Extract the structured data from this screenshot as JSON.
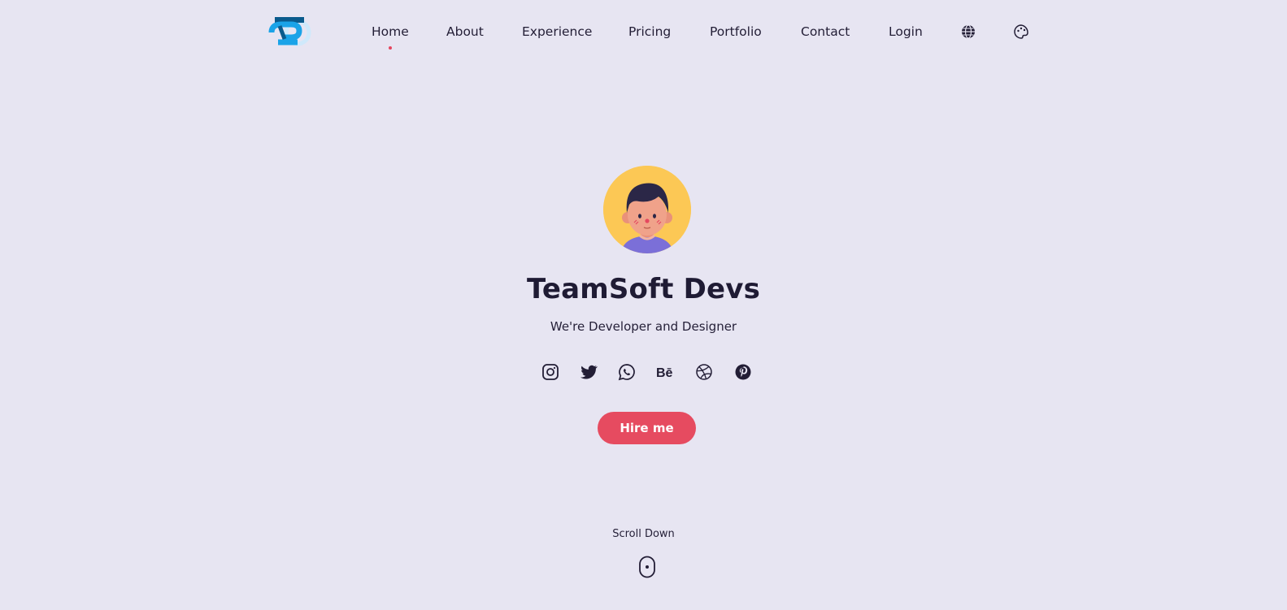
{
  "nav": {
    "items": [
      {
        "label": "Home",
        "active": true
      },
      {
        "label": "About",
        "active": false
      },
      {
        "label": "Experience",
        "active": false
      },
      {
        "label": "Pricing",
        "active": false
      },
      {
        "label": "Portfolio",
        "active": false
      },
      {
        "label": "Contact",
        "active": false
      },
      {
        "label": "Login",
        "active": false
      }
    ],
    "icons": [
      "globe-icon",
      "palette-icon"
    ]
  },
  "hero": {
    "name": "TeamSoft Devs",
    "tagline": "We're Developer and Designer",
    "social_icons": [
      "instagram-icon",
      "twitter-icon",
      "whatsapp-icon",
      "behance-icon",
      "dribbble-icon",
      "pinterest-icon"
    ],
    "cta_label": "Hire me",
    "scroll_label": "Scroll Down"
  },
  "colors": {
    "background": "#e7e5f2",
    "accent": "#e64b60",
    "text": "#1f1b34",
    "logo_primary": "#1aa3e8",
    "logo_dark": "#0a5a8c",
    "avatar_bg": "#fcc855"
  }
}
